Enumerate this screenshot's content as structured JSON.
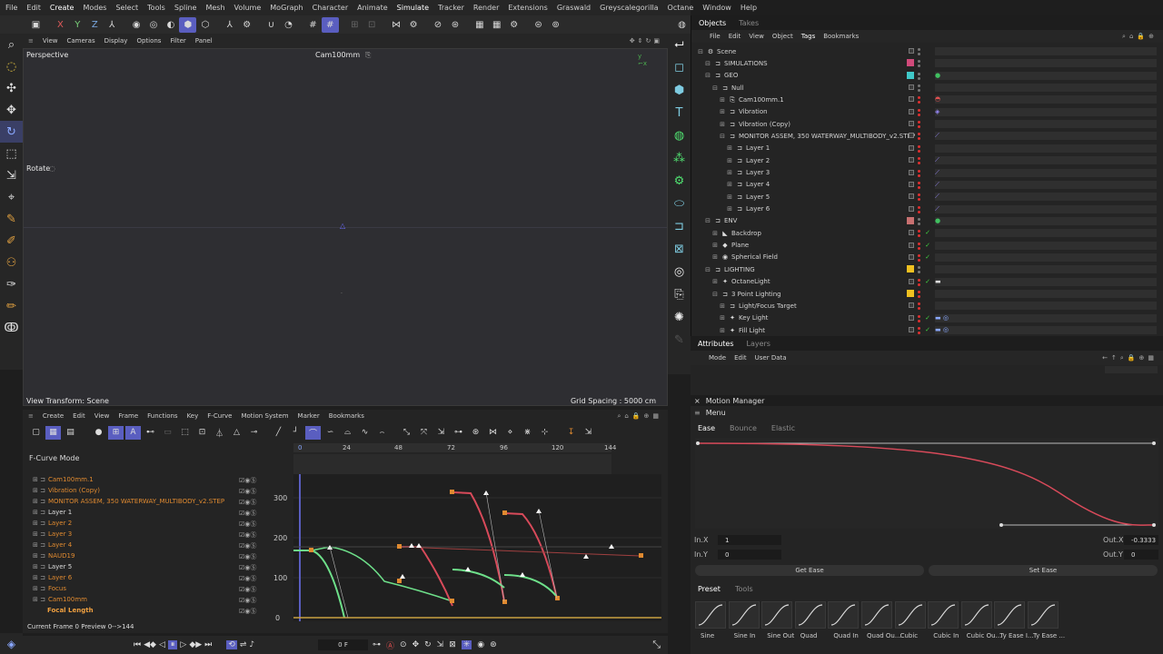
{
  "menubar": [
    "File",
    "Edit",
    "Create",
    "Modes",
    "Select",
    "Tools",
    "Spline",
    "Mesh",
    "Volume",
    "MoGraph",
    "Character",
    "Animate",
    "Simulate",
    "Tracker",
    "Render",
    "Extensions",
    "Graswald",
    "Greyscalegorilla",
    "Octane",
    "Window",
    "Help"
  ],
  "viewport": {
    "menu": [
      "View",
      "Cameras",
      "Display",
      "Options",
      "Filter",
      "Panel"
    ],
    "label": "Perspective",
    "camera": "Cam100mm",
    "tool_label": "Rotate",
    "view_transform": "View Transform: Scene",
    "grid_spacing": "Grid Spacing : 5000 cm"
  },
  "objects": {
    "tabs": [
      "Objects",
      "Takes"
    ],
    "menu": [
      "File",
      "Edit",
      "View",
      "Object",
      "Tags",
      "Bookmarks"
    ],
    "rows": [
      {
        "name": "Scene",
        "indent": 0
      },
      {
        "name": "SIMULATIONS",
        "indent": 1
      },
      {
        "name": "GEO",
        "indent": 1
      },
      {
        "name": "Null",
        "indent": 2
      },
      {
        "name": "Cam100mm.1",
        "indent": 3
      },
      {
        "name": "Vibration",
        "indent": 3
      },
      {
        "name": "Vibration (Copy)",
        "indent": 3
      },
      {
        "name": "MONITOR ASSEM, 350 WATERWAY_MULTIBODY_v2.STEP",
        "indent": 3
      },
      {
        "name": "Layer 1",
        "indent": 4
      },
      {
        "name": "Layer 2",
        "indent": 4
      },
      {
        "name": "Layer 3",
        "indent": 4
      },
      {
        "name": "Layer 4",
        "indent": 4
      },
      {
        "name": "Layer 5",
        "indent": 4
      },
      {
        "name": "Layer 6",
        "indent": 4
      },
      {
        "name": "ENV",
        "indent": 1
      },
      {
        "name": "Backdrop",
        "indent": 2
      },
      {
        "name": "Plane",
        "indent": 2
      },
      {
        "name": "Spherical Field",
        "indent": 2
      },
      {
        "name": "LIGHTING",
        "indent": 1
      },
      {
        "name": "OctaneLight",
        "indent": 2
      },
      {
        "name": "3 Point Lighting",
        "indent": 2
      },
      {
        "name": "Light/Focus Target",
        "indent": 3
      },
      {
        "name": "Key Light",
        "indent": 3
      },
      {
        "name": "Fill Light",
        "indent": 3
      }
    ]
  },
  "attributes": {
    "tabs": [
      "Attributes",
      "Layers"
    ],
    "menu": [
      "Mode",
      "Edit",
      "User Data"
    ]
  },
  "timeline": {
    "menu": [
      "Create",
      "Edit",
      "View",
      "Frame",
      "Functions",
      "Key",
      "F-Curve",
      "Motion System",
      "Marker",
      "Bookmarks"
    ],
    "mode_label": "F-Curve Mode",
    "tracks": [
      "Cam100mm.1",
      "Vibration (Copy)",
      "MONITOR ASSEM, 350 WATERWAY_MULTIBODY_v2.STEP",
      "Layer 1",
      "Layer 2",
      "Layer 3",
      "Layer 4",
      "NAUD19",
      "Layer 5",
      "Layer 6",
      "Focus",
      "Cam100mm",
      "Focal Length"
    ],
    "ruler": [
      "0",
      "24",
      "48",
      "72",
      "96",
      "120",
      "144"
    ],
    "y_labels": [
      "300",
      "200",
      "100",
      "0"
    ],
    "status": "Current Frame  0  Preview  0-->144",
    "frame_field": "0 F"
  },
  "motion_manager": {
    "title": "Motion Manager",
    "menu": "Menu",
    "tabs": [
      "Ease",
      "Bounce",
      "Elastic"
    ],
    "in_x_label": "In.X",
    "in_x": "1",
    "in_y_label": "In.Y",
    "in_y": "0",
    "out_x_label": "Out.X",
    "out_x": "-0.3333",
    "out_y_label": "Out.Y",
    "out_y": "0",
    "get_ease": "Get Ease",
    "set_ease": "Set Ease",
    "preset_tabs": [
      "Preset",
      "Tools"
    ],
    "presets": [
      "Sine",
      "Sine In",
      "Sine Out",
      "Quad",
      "Quad In",
      "Quad Ou...",
      "Cubic",
      "Cubic In",
      "Cubic Ou...",
      "Ty Ease I...",
      "Ty Ease ..."
    ]
  },
  "colors": {
    "accent": "#5a5ec0",
    "curve_red": "#d84a5a",
    "curve_green": "#6ee08a",
    "orange": "#e08a30"
  }
}
